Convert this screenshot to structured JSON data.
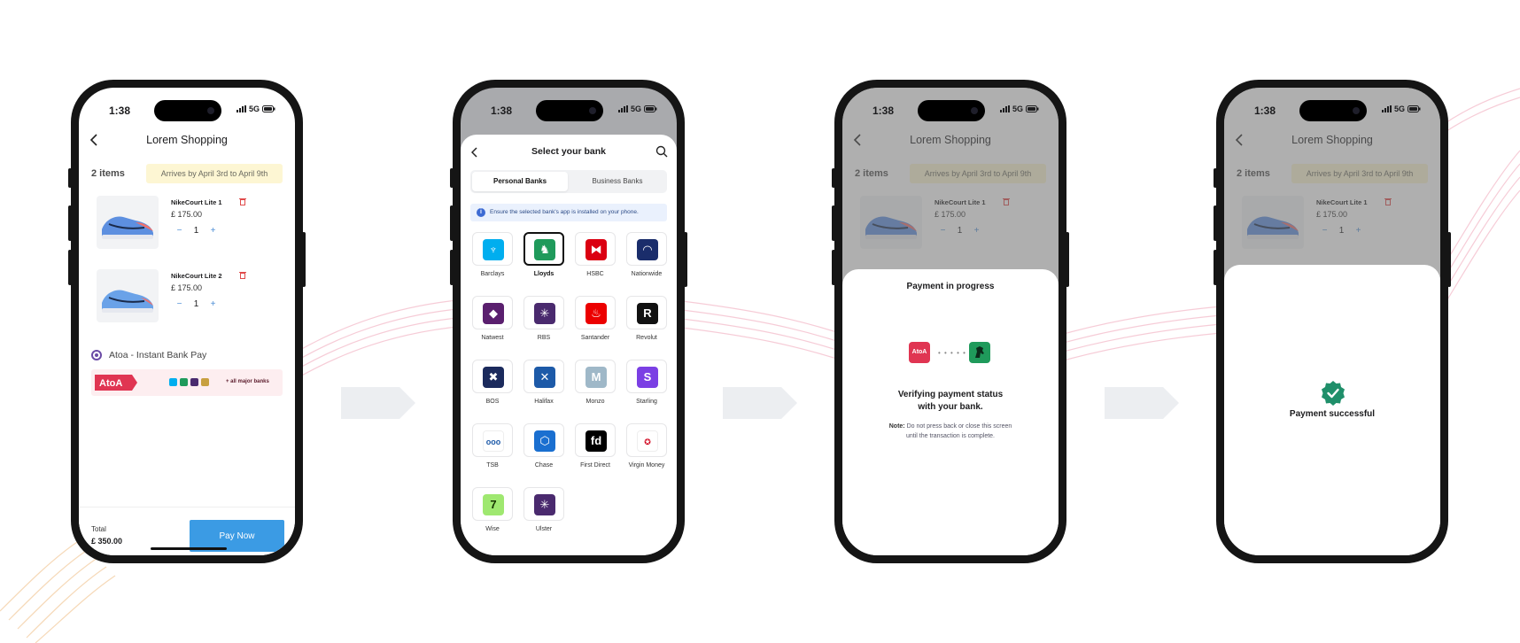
{
  "status": {
    "time": "1:38",
    "network": "5G"
  },
  "cart": {
    "title": "Lorem Shopping",
    "items_count": "2 items",
    "arrival": "Arrives by April 3rd to April 9th",
    "products": [
      {
        "name": "NikeCourt Lite 1",
        "price": "£ 175.00",
        "qty": "1"
      },
      {
        "name": "NikeCourt Lite 2",
        "price": "£ 175.00",
        "qty": "1"
      }
    ],
    "payment_method": "Atoa - Instant Bank Pay",
    "banner_logo": "AtoA",
    "banner_text": "+ all major banks",
    "total_label": "Total",
    "total_value": "£ 350.00",
    "pay_button": "Pay Now",
    "minus": "−",
    "plus": "+"
  },
  "banks": {
    "title": "Select your bank",
    "tabs": [
      "Personal Banks",
      "Business Banks"
    ],
    "info": "Ensure the selected bank's app is installed on your phone.",
    "list": [
      {
        "name": "Barclays",
        "color": "#00aeef",
        "glyph": "♆"
      },
      {
        "name": "Lloyds",
        "color": "#1f9a5b",
        "glyph": "♞",
        "selected": true
      },
      {
        "name": "HSBC",
        "color": "#db0011",
        "glyph": "⧓"
      },
      {
        "name": "Nationwide",
        "color": "#1a2d6b",
        "glyph": "◠"
      },
      {
        "name": "Natwest",
        "color": "#5a1f6e",
        "glyph": "◆"
      },
      {
        "name": "RBS",
        "color": "#4a2a6e",
        "glyph": "✳"
      },
      {
        "name": "Santander",
        "color": "#ec0000",
        "glyph": "♨"
      },
      {
        "name": "Revolut",
        "color": "#111111",
        "glyph": "R"
      },
      {
        "name": "BOS",
        "color": "#1b2a5c",
        "glyph": "✖"
      },
      {
        "name": "Halifax",
        "color": "#1d5aa8",
        "glyph": "✕"
      },
      {
        "name": "Monzo",
        "color": "#9fb8c8",
        "glyph": "M"
      },
      {
        "name": "Starling",
        "color": "#7b3fe4",
        "glyph": "S"
      },
      {
        "name": "TSB",
        "color": "#ffffff",
        "glyph": "ooo"
      },
      {
        "name": "Chase",
        "color": "#1a6fd0",
        "glyph": "⬡"
      },
      {
        "name": "First Direct",
        "color": "#000000",
        "glyph": "fd"
      },
      {
        "name": "Virgin Money",
        "color": "#ffffff",
        "glyph": "✪"
      },
      {
        "name": "Wise",
        "color": "#9fe870",
        "glyph": "7"
      },
      {
        "name": "Ulster",
        "color": "#4a2a6e",
        "glyph": "✳"
      }
    ]
  },
  "progress": {
    "title": "Payment in progress",
    "atoa": "AtoA",
    "dots": "• • • • • •",
    "verify_line1": "Verifying payment status",
    "verify_line2": "with your bank.",
    "note_label": "Note:",
    "note_line1": "Do not press back or close this screen",
    "note_line2": "until the transaction is complete."
  },
  "success": {
    "text": "Payment successful"
  },
  "colors": {
    "accent": "#3b9be4",
    "atoa": "#e03552",
    "success": "#1f8f6a",
    "arrow": "#eceef1"
  }
}
